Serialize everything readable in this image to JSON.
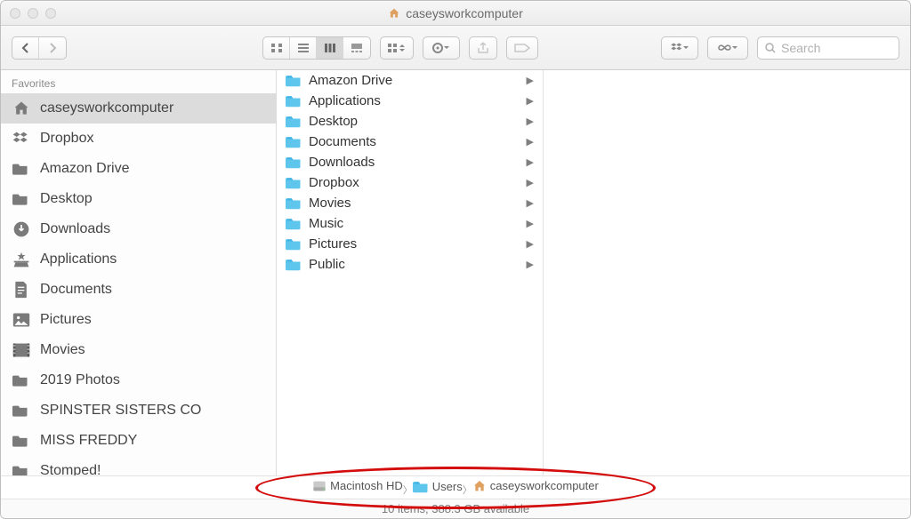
{
  "window": {
    "title": "caseysworkcomputer"
  },
  "search": {
    "placeholder": "Search"
  },
  "sidebar": {
    "heading": "Favorites",
    "items": [
      {
        "label": "caseysworkcomputer",
        "icon": "home-icon",
        "selected": true
      },
      {
        "label": "Dropbox",
        "icon": "dropbox-icon",
        "selected": false
      },
      {
        "label": "Amazon Drive",
        "icon": "folder-icon",
        "selected": false
      },
      {
        "label": "Desktop",
        "icon": "folder-icon",
        "selected": false
      },
      {
        "label": "Downloads",
        "icon": "downloads-icon",
        "selected": false
      },
      {
        "label": "Applications",
        "icon": "applications-icon",
        "selected": false
      },
      {
        "label": "Documents",
        "icon": "documents-icon",
        "selected": false
      },
      {
        "label": "Pictures",
        "icon": "pictures-icon",
        "selected": false
      },
      {
        "label": "Movies",
        "icon": "movies-icon",
        "selected": false
      },
      {
        "label": "2019 Photos",
        "icon": "folder-icon",
        "selected": false
      },
      {
        "label": "SPINSTER SISTERS CO",
        "icon": "folder-icon",
        "selected": false
      },
      {
        "label": "MISS FREDDY",
        "icon": "folder-icon",
        "selected": false
      },
      {
        "label": "Stomped!",
        "icon": "folder-icon",
        "selected": false
      }
    ]
  },
  "column": {
    "items": [
      {
        "label": "Amazon Drive",
        "icon": "folder-blue-icon",
        "has_children": true
      },
      {
        "label": "Applications",
        "icon": "folder-blue-icon",
        "has_children": true
      },
      {
        "label": "Desktop",
        "icon": "folder-blue-icon",
        "has_children": true
      },
      {
        "label": "Documents",
        "icon": "folder-blue-icon",
        "has_children": true
      },
      {
        "label": "Downloads",
        "icon": "folder-blue-icon",
        "has_children": true
      },
      {
        "label": "Dropbox",
        "icon": "folder-blue-icon",
        "has_children": true
      },
      {
        "label": "Movies",
        "icon": "folder-blue-icon",
        "has_children": true
      },
      {
        "label": "Music",
        "icon": "folder-blue-icon",
        "has_children": true
      },
      {
        "label": "Pictures",
        "icon": "folder-blue-icon",
        "has_children": true
      },
      {
        "label": "Public",
        "icon": "folder-blue-icon",
        "has_children": true
      }
    ]
  },
  "pathbar": {
    "crumbs": [
      {
        "label": "Macintosh HD",
        "icon": "disk-icon"
      },
      {
        "label": "Users",
        "icon": "folder-blue-icon"
      },
      {
        "label": "caseysworkcomputer",
        "icon": "home-color-icon"
      }
    ]
  },
  "status": {
    "text": "10 items, 388.3 GB available"
  }
}
